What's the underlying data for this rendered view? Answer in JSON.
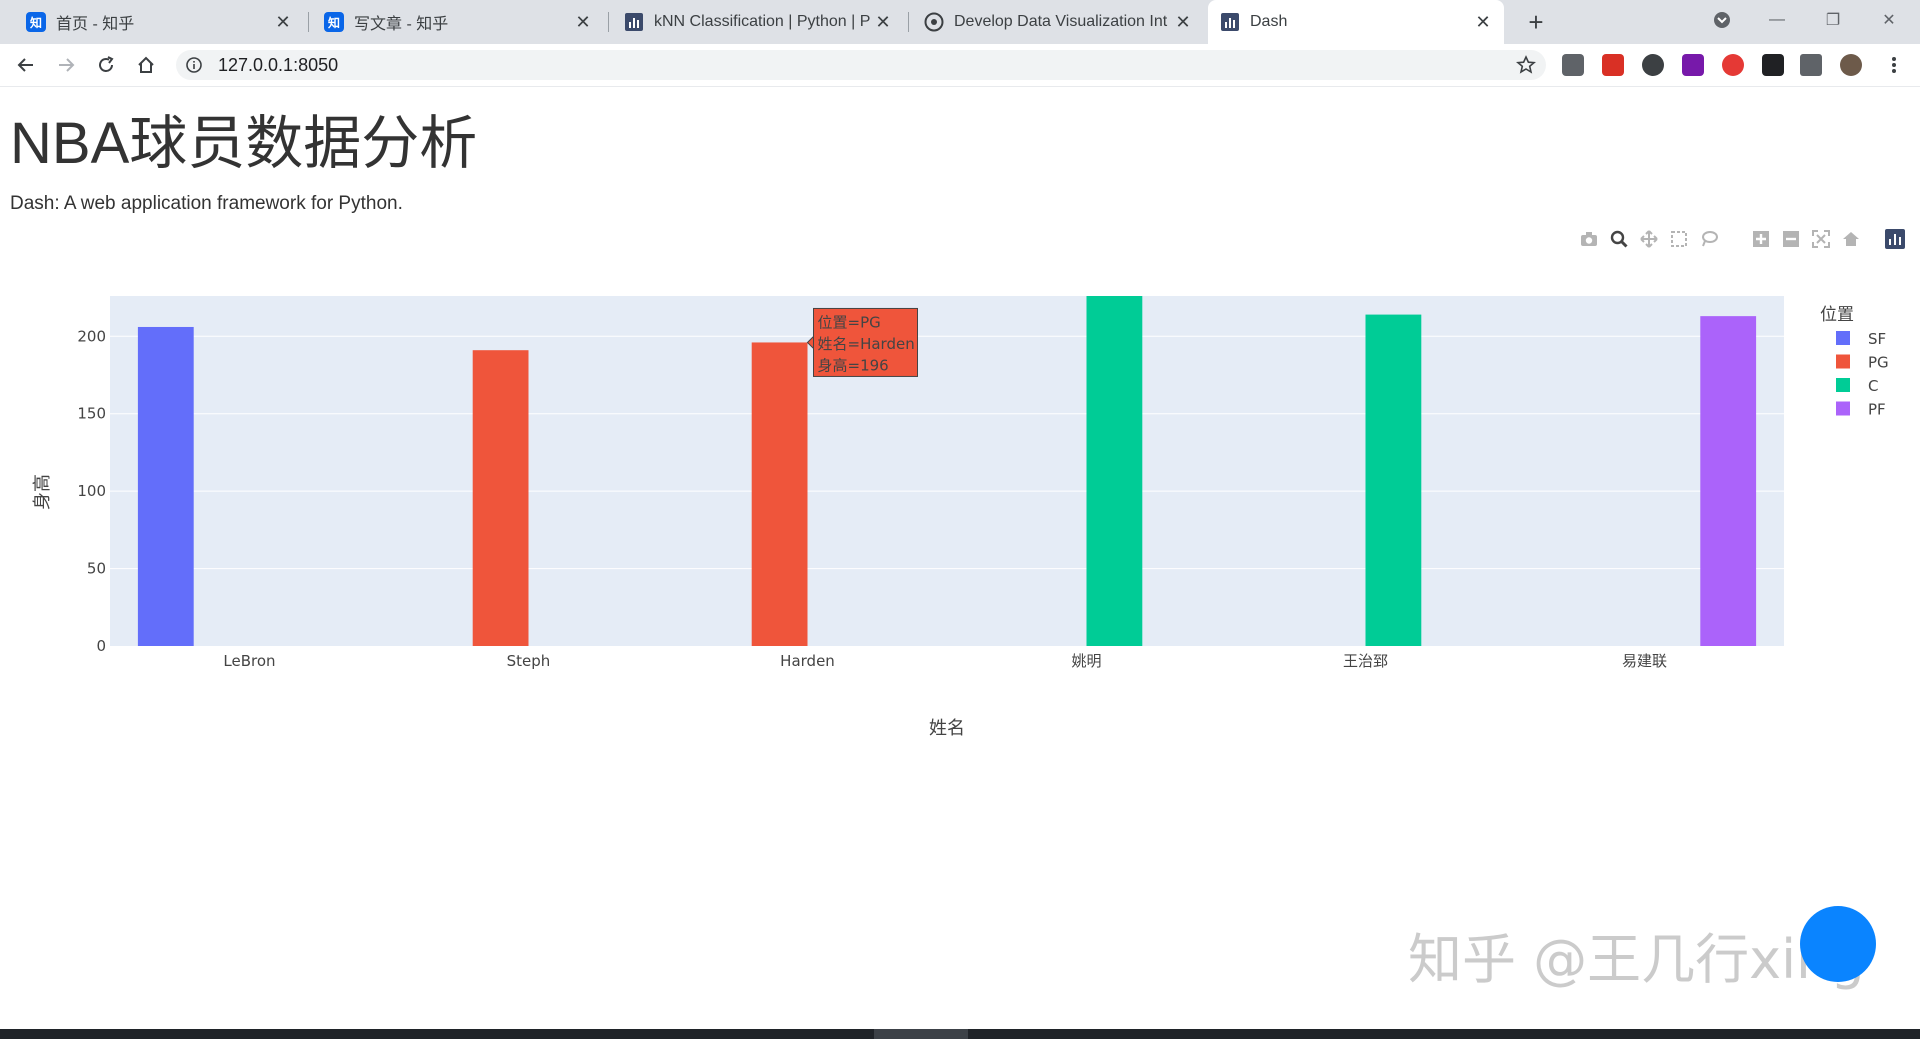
{
  "browser": {
    "tabs": [
      {
        "title": "首页 - 知乎",
        "icon": "zhihu-icon",
        "active": false
      },
      {
        "title": "写文章 - 知乎",
        "icon": "zhihu-icon",
        "active": false
      },
      {
        "title": "kNN Classification | Python | P",
        "icon": "plotly-icon",
        "active": false
      },
      {
        "title": "Develop Data Visualization Int",
        "icon": "globe-icon",
        "active": false
      },
      {
        "title": "Dash",
        "icon": "dash-icon",
        "active": true
      }
    ],
    "url": "127.0.0.1:8050"
  },
  "page": {
    "title": "NBA球员数据分析",
    "subtitle": "Dash: A web application framework for Python."
  },
  "chart_data": {
    "type": "bar",
    "categories": [
      "LeBron",
      "Steph",
      "Harden",
      "姚明",
      "王治郅",
      "易建联"
    ],
    "series": [
      {
        "name": "SF",
        "color": "#636efa",
        "values": [
          206,
          null,
          null,
          null,
          null,
          null
        ]
      },
      {
        "name": "PG",
        "color": "#ef553b",
        "values": [
          null,
          191,
          196,
          null,
          null,
          null
        ]
      },
      {
        "name": "C",
        "color": "#00cc96",
        "values": [
          null,
          null,
          null,
          226,
          214,
          null
        ]
      },
      {
        "name": "PF",
        "color": "#ab63fa",
        "values": [
          null,
          null,
          null,
          null,
          null,
          213
        ]
      }
    ],
    "xlabel": "姓名",
    "ylabel": "身高",
    "ylim": [
      0,
      226
    ],
    "yticks": [
      0,
      50,
      100,
      150,
      200
    ],
    "legend_title": "位置",
    "legend_position": "right",
    "grid": true,
    "barmode": "group",
    "tooltip": {
      "lines": [
        "位置=PG",
        "姓名=Harden",
        "身高=196"
      ]
    }
  },
  "watermark": "知乎 @王几行xing"
}
